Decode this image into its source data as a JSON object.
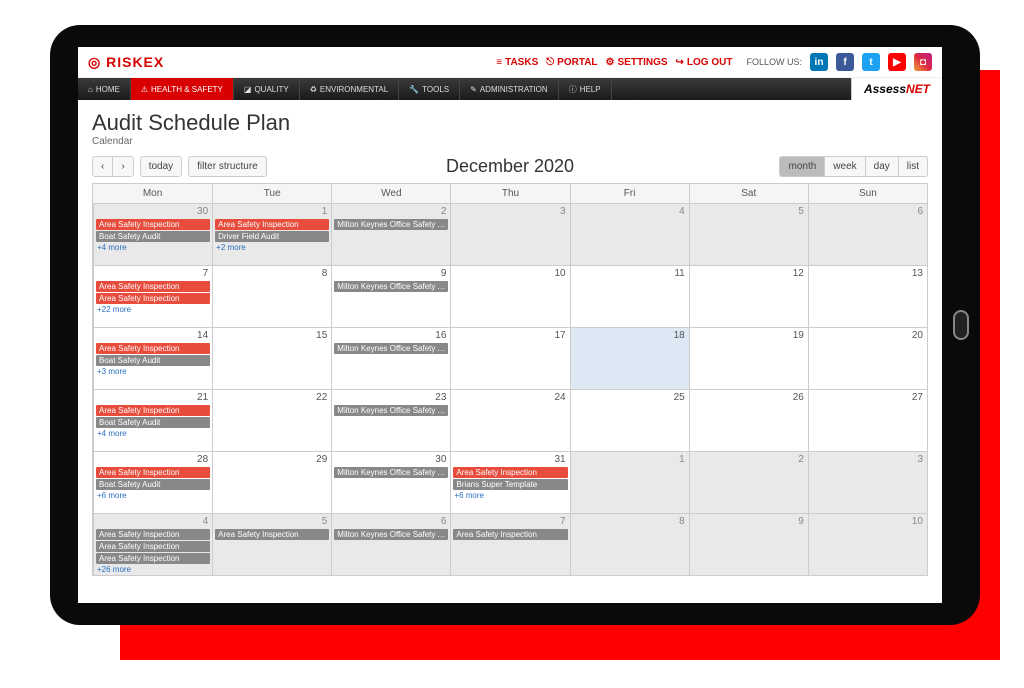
{
  "brand": {
    "riskex": "RISKEX",
    "assess": "Assess",
    "net": "NET"
  },
  "topbar": {
    "tasks": "TASKS",
    "portal": "PORTAL",
    "settings": "SETTINGS",
    "logout": "LOG OUT",
    "follow": "FOLLOW US:",
    "i_tasks": "≡",
    "i_portal": "⎋",
    "i_settings": "⚙",
    "i_logout": "↪"
  },
  "nav": {
    "home": "HOME",
    "hs": "HEALTH & SAFETY",
    "quality": "QUALITY",
    "env": "ENVIRONMENTAL",
    "tools": "TOOLS",
    "admin": "ADMINISTRATION",
    "help": "HELP",
    "i_home": "⌂",
    "i_hs": "⚠",
    "i_quality": "◪",
    "i_env": "♻",
    "i_tools": "🔧",
    "i_admin": "✎",
    "i_help": "ⓘ"
  },
  "page": {
    "title": "Audit Schedule Plan",
    "subtitle": "Calendar"
  },
  "toolbar": {
    "prev": "‹",
    "next": "›",
    "today": "today",
    "filter": "filter structure",
    "title": "December 2020",
    "month": "month",
    "week": "week",
    "day": "day",
    "list": "list"
  },
  "days": {
    "mon": "Mon",
    "tue": "Tue",
    "wed": "Wed",
    "thu": "Thu",
    "fri": "Fri",
    "sat": "Sat",
    "sun": "Sun"
  },
  "cells": [
    {
      "n": "30",
      "o": 1,
      "ev": [
        {
          "t": "Area Safety Inspection",
          "c": "red"
        },
        {
          "t": "Boat Safety Audit",
          "c": "grey"
        }
      ],
      "m": "+4 more"
    },
    {
      "n": "1",
      "o": 1,
      "ev": [
        {
          "t": "Area Safety Inspection",
          "c": "red"
        },
        {
          "t": "Driver Field Audit",
          "c": "grey"
        }
      ],
      "m": "+2 more"
    },
    {
      "n": "2",
      "o": 1,
      "ev": [
        {
          "t": "Milton Keynes Office Safety Au",
          "c": "grey"
        }
      ]
    },
    {
      "n": "3",
      "o": 1
    },
    {
      "n": "4",
      "o": 1
    },
    {
      "n": "5",
      "o": 1
    },
    {
      "n": "6",
      "o": 1
    },
    {
      "n": "7",
      "ev": [
        {
          "t": "Area Safety Inspection",
          "c": "red"
        },
        {
          "t": "Area Safety Inspection",
          "c": "red"
        }
      ],
      "m": "+22 more"
    },
    {
      "n": "8"
    },
    {
      "n": "9",
      "ev": [
        {
          "t": "Milton Keynes Office Safety Au",
          "c": "grey"
        }
      ]
    },
    {
      "n": "10"
    },
    {
      "n": "11"
    },
    {
      "n": "12"
    },
    {
      "n": "13"
    },
    {
      "n": "14",
      "ev": [
        {
          "t": "Area Safety Inspection",
          "c": "red"
        },
        {
          "t": "Boat Safety Audit",
          "c": "grey"
        }
      ],
      "m": "+3 more"
    },
    {
      "n": "15"
    },
    {
      "n": "16",
      "ev": [
        {
          "t": "Milton Keynes Office Safety Au",
          "c": "grey"
        }
      ]
    },
    {
      "n": "17"
    },
    {
      "n": "18",
      "hl": 1
    },
    {
      "n": "19"
    },
    {
      "n": "20"
    },
    {
      "n": "21",
      "ev": [
        {
          "t": "Area Safety Inspection",
          "c": "red"
        },
        {
          "t": "Boat Safety Audit",
          "c": "grey"
        }
      ],
      "m": "+4 more"
    },
    {
      "n": "22"
    },
    {
      "n": "23",
      "ev": [
        {
          "t": "Milton Keynes Office Safety Au",
          "c": "grey"
        }
      ]
    },
    {
      "n": "24"
    },
    {
      "n": "25"
    },
    {
      "n": "26"
    },
    {
      "n": "27"
    },
    {
      "n": "28",
      "ev": [
        {
          "t": "Area Safety Inspection",
          "c": "red"
        },
        {
          "t": "Boat Safety Audit",
          "c": "grey"
        }
      ],
      "m": "+6 more"
    },
    {
      "n": "29"
    },
    {
      "n": "30",
      "ev": [
        {
          "t": "Milton Keynes Office Safety Au",
          "c": "grey"
        }
      ]
    },
    {
      "n": "31",
      "ev": [
        {
          "t": "Area Safety Inspection",
          "c": "red"
        },
        {
          "t": "Brians Super Template",
          "c": "grey"
        }
      ],
      "m": "+6 more"
    },
    {
      "n": "1",
      "o": 1
    },
    {
      "n": "2",
      "o": 1
    },
    {
      "n": "3",
      "o": 1
    },
    {
      "n": "4",
      "o": 1,
      "ev": [
        {
          "t": "Area Safety Inspection",
          "c": "grey"
        },
        {
          "t": "Area Safety Inspection",
          "c": "grey"
        },
        {
          "t": "Area Safety Inspection",
          "c": "grey"
        }
      ],
      "m": "+26 more"
    },
    {
      "n": "5",
      "o": 1,
      "ev": [
        {
          "t": "Area Safety Inspection",
          "c": "grey"
        }
      ]
    },
    {
      "n": "6",
      "o": 1,
      "ev": [
        {
          "t": "Milton Keynes Office Safety Au",
          "c": "grey"
        }
      ]
    },
    {
      "n": "7",
      "o": 1,
      "ev": [
        {
          "t": "Area Safety Inspection",
          "c": "grey"
        }
      ]
    },
    {
      "n": "8",
      "o": 1
    },
    {
      "n": "9",
      "o": 1
    },
    {
      "n": "10",
      "o": 1
    }
  ]
}
